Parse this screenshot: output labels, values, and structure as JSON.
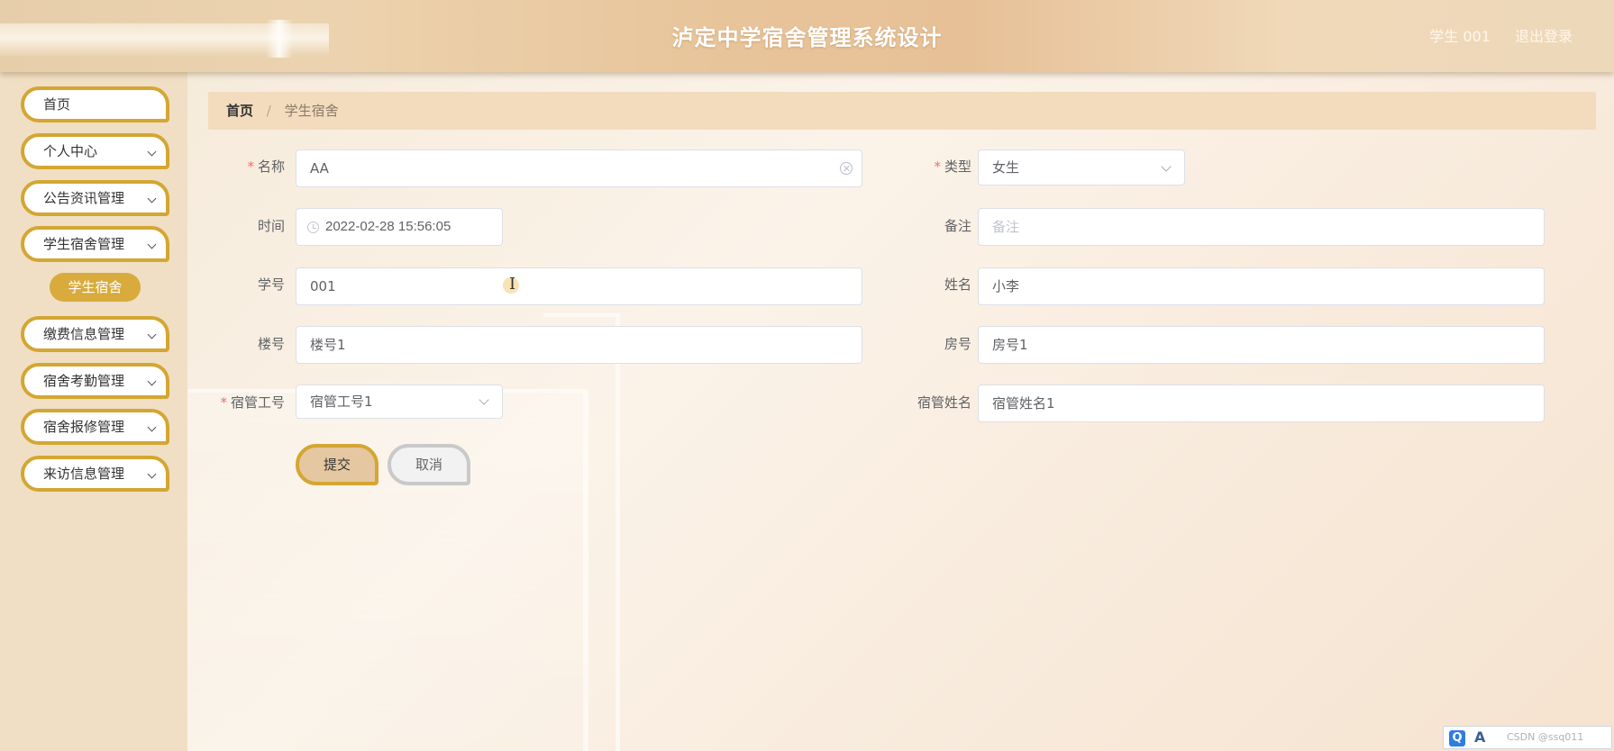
{
  "header": {
    "title": "泸定中学宿舍管理系统设计",
    "user_label": "学生 001",
    "logout_label": "退出登录"
  },
  "sidebar": {
    "items": [
      {
        "label": "首页",
        "has_arrow": false
      },
      {
        "label": "个人中心",
        "has_arrow": true
      },
      {
        "label": "公告资讯管理",
        "has_arrow": true
      },
      {
        "label": "学生宿舍管理",
        "has_arrow": true
      },
      {
        "label": "缴费信息管理",
        "has_arrow": true
      },
      {
        "label": "宿舍考勤管理",
        "has_arrow": true
      },
      {
        "label": "宿舍报修管理",
        "has_arrow": true
      },
      {
        "label": "来访信息管理",
        "has_arrow": true
      }
    ],
    "active_sub_item": "学生宿舍"
  },
  "breadcrumb": {
    "home": "首页",
    "separator": "/",
    "current": "学生宿舍"
  },
  "form": {
    "name": {
      "label": "名称",
      "value": "AA",
      "required": true
    },
    "type": {
      "label": "类型",
      "value": "女生",
      "required": true
    },
    "time": {
      "label": "时间",
      "value": "2022-02-28 15:56:05"
    },
    "remark": {
      "label": "备注",
      "value": "",
      "placeholder": "备注"
    },
    "student_no": {
      "label": "学号",
      "value": "001"
    },
    "student_name": {
      "label": "姓名",
      "value": "小李"
    },
    "building_no": {
      "label": "楼号",
      "value": "楼号1"
    },
    "room_no": {
      "label": "房号",
      "value": "房号1"
    },
    "manager_id": {
      "label": "宿管工号",
      "value": "宿管工号1",
      "required": true
    },
    "manager_name": {
      "label": "宿管姓名",
      "value": "宿管姓名1"
    }
  },
  "buttons": {
    "submit": "提交",
    "cancel": "取消"
  },
  "ime_toolbar": {
    "logo": "Q",
    "mode": "A",
    "watermark": "CSDN @ssq011"
  },
  "colors": {
    "accent_gold": "#d4a632",
    "submenu_active": "#d8ab3c",
    "required_star": "#f56c6c"
  }
}
